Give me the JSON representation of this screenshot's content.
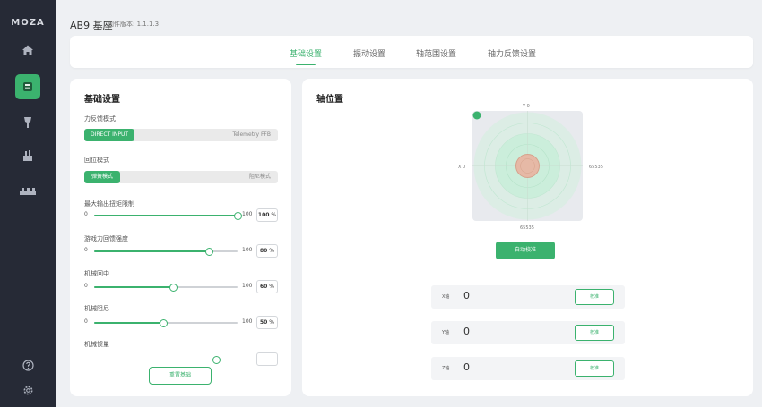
{
  "app": {
    "logo": "MOZA",
    "device_name": "AB9 基座",
    "firmware_version": "固件版本: 1.1.1.3"
  },
  "sidebar": {
    "items": [
      {
        "icon": "home-icon",
        "active": false
      },
      {
        "icon": "base-icon",
        "active": true
      },
      {
        "icon": "joystick-icon",
        "active": false
      },
      {
        "icon": "throttle-icon",
        "active": false
      },
      {
        "icon": "pedals-icon",
        "active": false
      }
    ],
    "bottom_icons": [
      "help-icon",
      "settings-icon"
    ]
  },
  "tabs": [
    {
      "label": "基础设置",
      "active": true
    },
    {
      "label": "振动设置",
      "active": false
    },
    {
      "label": "轴范围设置",
      "active": false
    },
    {
      "label": "轴力反馈设置",
      "active": false
    }
  ],
  "basic": {
    "title": "基础设置",
    "ffb_mode": {
      "label": "力反馈模式",
      "selected": "DIRECT INPUT",
      "other": "Telemetry FFB"
    },
    "stop_mode": {
      "label": "回位模式",
      "selected": "弹簧模式",
      "other": "阻尼模式"
    },
    "sliders": [
      {
        "label": "最大输出扭矩限制",
        "min": "0",
        "max": "100",
        "value": "100",
        "unit": "%",
        "fraction": 1.0
      },
      {
        "label": "游戏力回馈强度",
        "min": "0",
        "max": "100",
        "value": "80",
        "unit": "%",
        "fraction": 0.8
      },
      {
        "label": "机械回中",
        "min": "0",
        "max": "100",
        "value": "60",
        "unit": "%",
        "fraction": 0.55
      },
      {
        "label": "机械阻尼",
        "min": "0",
        "max": "100",
        "value": "50",
        "unit": "%",
        "fraction": 0.48
      },
      {
        "label": "机械惯量",
        "min": "",
        "max": "",
        "value": "",
        "unit": "",
        "fraction": 0.85
      }
    ],
    "reset_label": "重置基础"
  },
  "axis": {
    "title": "轴位置",
    "top_label": "Y 0",
    "left_label": "X 0",
    "right_label": "65535",
    "bottom_label": "65535",
    "calibrate_label": "自动校准",
    "rows": [
      {
        "name": "X轴",
        "value": "0",
        "button": "校准"
      },
      {
        "name": "Y轴",
        "value": "0",
        "button": "校准"
      },
      {
        "name": "Z轴",
        "value": "0",
        "button": "校准"
      }
    ]
  },
  "colors": {
    "accent": "#3bb26e",
    "sidebar": "#262a36",
    "background": "#eef0f3"
  }
}
